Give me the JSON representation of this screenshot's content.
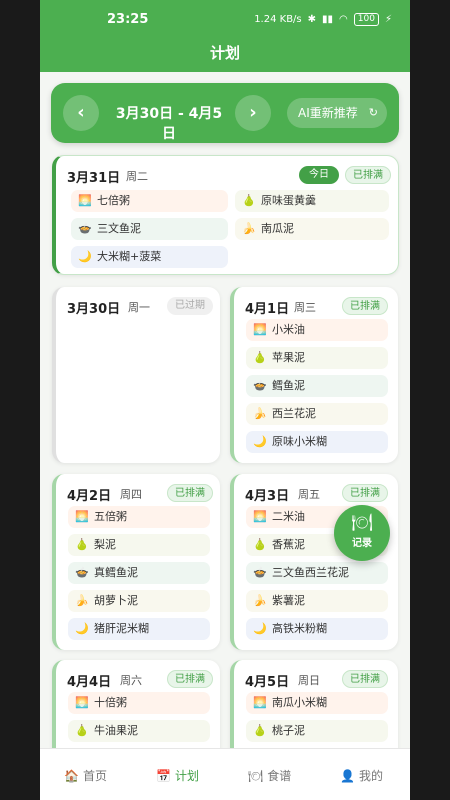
{
  "status": {
    "time": "23:25",
    "net": "1.24 KB/s",
    "battery": "100"
  },
  "title": "计划",
  "week": {
    "range": "3月30日 - 4月5日",
    "prev": "‹",
    "next": "›",
    "ai_label": "AI重新推荐",
    "ai_icon": "↻"
  },
  "icons": {
    "breakfast": "🌅",
    "fruit": "🍐",
    "lunch": "🍲",
    "snack": "🍌",
    "dinner": "🌙",
    "fab": "🍽"
  },
  "days": {
    "today": {
      "date": "3月31日",
      "weekday": "周二",
      "badge_today": "今日",
      "badge": "已排满",
      "meals": [
        "七倍粥",
        "原味蛋黄羹",
        "三文鱼泥",
        "南瓜泥",
        "大米糊+菠菜"
      ]
    },
    "d0330": {
      "date": "3月30日",
      "weekday": "周一",
      "badge": "已过期"
    },
    "d0401": {
      "date": "4月1日",
      "weekday": "周三",
      "badge": "已排满",
      "meals": [
        "小米油",
        "苹果泥",
        "鳕鱼泥",
        "西兰花泥",
        "原味小米糊"
      ]
    },
    "d0402": {
      "date": "4月2日",
      "weekday": "周四",
      "badge": "已排满",
      "meals": [
        "五倍粥",
        "梨泥",
        "真鳕鱼泥",
        "胡萝卜泥",
        "猪肝泥米糊"
      ]
    },
    "d0403": {
      "date": "4月3日",
      "weekday": "周五",
      "badge": "已排满",
      "meals": [
        "二米油",
        "香蕉泥",
        "三文鱼西兰花泥",
        "紫薯泥",
        "高铁米粉糊"
      ]
    },
    "d0404": {
      "date": "4月4日",
      "weekday": "周六",
      "badge": "已排满",
      "meals": [
        "十倍粥",
        "牛油果泥"
      ]
    },
    "d0405": {
      "date": "4月5日",
      "weekday": "周日",
      "badge": "已排满",
      "meals": [
        "南瓜小米糊",
        "桃子泥"
      ]
    }
  },
  "fab_label": "记录",
  "tabs": [
    {
      "label": "首页",
      "icon": "🏠"
    },
    {
      "label": "计划",
      "icon": "📅"
    },
    {
      "label": "食谱",
      "icon": "🍽"
    },
    {
      "label": "我的",
      "icon": "👤"
    }
  ],
  "colors": {
    "primary": "#4caf50",
    "accent": "#43a047",
    "background": "#f4f6f3"
  }
}
